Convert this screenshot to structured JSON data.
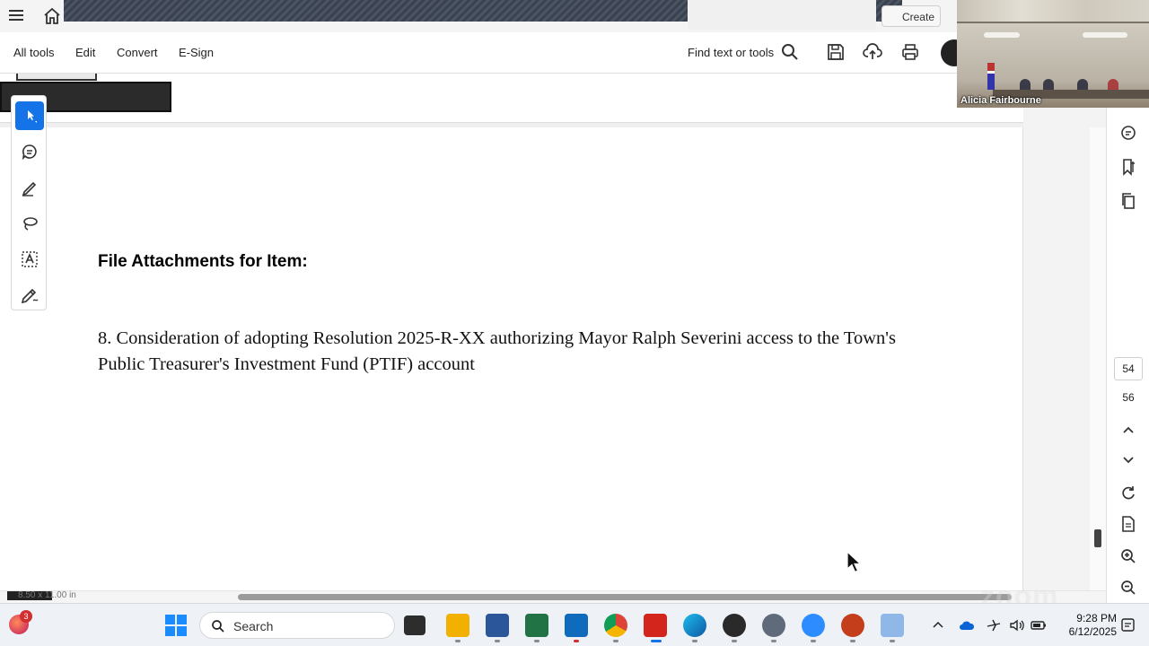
{
  "topbar": {
    "create_label": "Create"
  },
  "menubar": {
    "items": [
      "All tools",
      "Edit",
      "Convert",
      "E-Sign"
    ],
    "find_label": "Find text or tools"
  },
  "document": {
    "heading": "File Attachments for Item:",
    "item_text": "8. Consideration of adopting Resolution 2025-R-XX authorizing Mayor Ralph Severini access to the Town's Public Treasurer's Investment Fund (PTIF) account"
  },
  "left_rail": {
    "tools": [
      "select-tool",
      "comment-tool",
      "draw-tool",
      "lasso-tool",
      "text-recognition-tool",
      "sign-tool"
    ]
  },
  "right_rail": {
    "page_current": "54",
    "page_total": "56"
  },
  "statusbar": {
    "page_size": "8.50 x 11.00 in"
  },
  "video": {
    "participant_name": "Alicia Fairbourne"
  },
  "taskbar": {
    "search_label": "Search",
    "notification_count": "3",
    "time": "9:28 PM",
    "date": "6/12/2025",
    "zoom_watermark": "zoom"
  },
  "colors": {
    "accent": "#1473e6",
    "windows_blue": "#1a8cff"
  }
}
